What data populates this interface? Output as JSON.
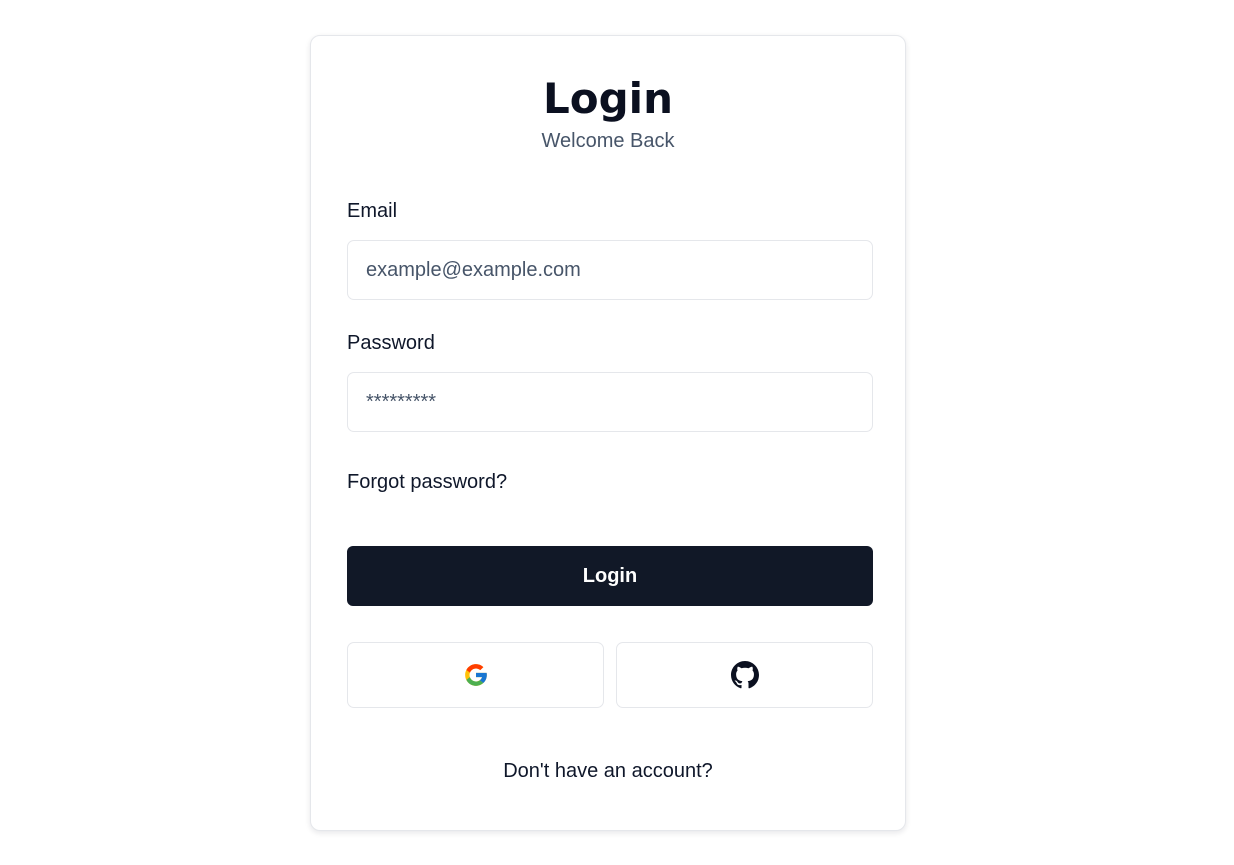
{
  "header": {
    "title": "Login",
    "subtitle": "Welcome Back"
  },
  "form": {
    "email_label": "Email",
    "email_placeholder": "example@example.com",
    "password_label": "Password",
    "password_placeholder": "*********",
    "forgot_link": "Forgot password?",
    "login_button": "Login"
  },
  "social": {
    "google_icon": "google-icon",
    "github_icon": "github-icon"
  },
  "footer": {
    "signup_prompt": "Don't have an account?"
  },
  "colors": {
    "primary_button": "#111827",
    "border": "#e5e7eb",
    "muted_text": "#475569"
  }
}
